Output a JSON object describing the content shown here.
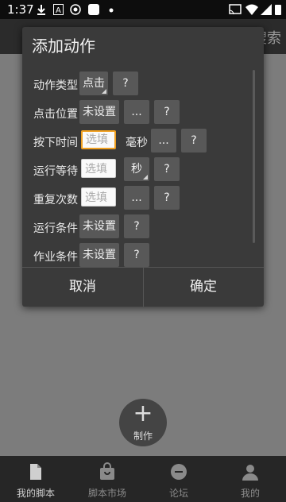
{
  "status_bar": {
    "time": "1:37",
    "left_icons": [
      "download-icon",
      "a-box-icon",
      "vpn-icon",
      "square-app-icon",
      "dot-icon"
    ],
    "right_icons": [
      "cast-icon",
      "wifi-icon",
      "signal-icon",
      "battery-icon"
    ]
  },
  "app_bar": {
    "search_label": "搜索"
  },
  "fab": {
    "label": "制作"
  },
  "bottom_nav": [
    {
      "label": "我的脚本",
      "icon": "document-icon",
      "active": true
    },
    {
      "label": "脚本市场",
      "icon": "shopping-bag-icon",
      "active": false
    },
    {
      "label": "论坛",
      "icon": "chat-icon",
      "active": false
    },
    {
      "label": "我的",
      "icon": "person-icon",
      "active": false
    }
  ],
  "dialog": {
    "title": "添加动作",
    "rows": [
      {
        "label": "动作类型",
        "value": "点击",
        "help": "?"
      },
      {
        "label": "点击位置",
        "value": "未设置",
        "more": "...",
        "help": "?"
      },
      {
        "label": "按下时间",
        "placeholder": "选填",
        "unit": "毫秒",
        "more": "...",
        "help": "?"
      },
      {
        "label": "运行等待",
        "placeholder": "选填",
        "unit": "秒",
        "help": "?"
      },
      {
        "label": "重复次数",
        "placeholder": "选填",
        "more": "...",
        "help": "?"
      },
      {
        "label": "运行条件",
        "value": "未设置",
        "help": "?"
      },
      {
        "label": "作业条件",
        "value": "未设置",
        "help": "?"
      }
    ],
    "cancel": "取消",
    "confirm": "确定"
  }
}
